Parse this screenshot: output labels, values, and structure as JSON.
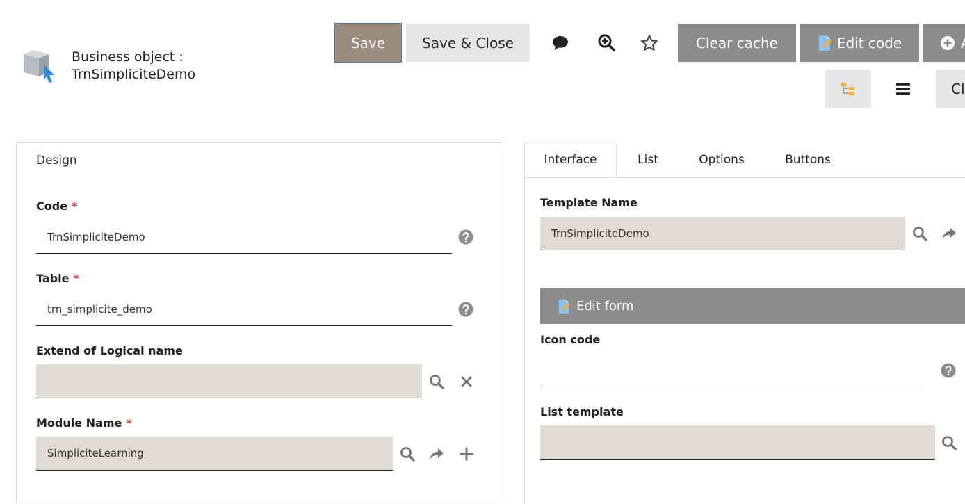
{
  "header": {
    "title_line1": "Business object :",
    "title_line2": "TrnSimpliciteDemo",
    "object_icon": "cube-with-cursor-icon"
  },
  "toolbar": {
    "save_label": "Save",
    "save_close_label": "Save & Close",
    "clear_cache_label": "Clear cache",
    "edit_code_label": "Edit code",
    "add_label_partial": "A",
    "more_label_partial": "Cl",
    "icons": [
      "comment-icon",
      "zoom-search-icon",
      "star-icon",
      "tree-icon",
      "menu-icon"
    ]
  },
  "design_panel": {
    "title": "Design",
    "code": {
      "label": "Code",
      "value": "TrnSimpliciteDemo",
      "required": "*"
    },
    "table": {
      "label": "Table",
      "value": "trn_simplicite_demo",
      "required": "*"
    },
    "extend": {
      "label": "Extend of Logical name",
      "value": ""
    },
    "module": {
      "label": "Module Name",
      "value": "SimpliciteLearning",
      "required": "*"
    }
  },
  "tabs": {
    "items": [
      "Interface",
      "List",
      "Options",
      "Buttons"
    ],
    "active": "Interface"
  },
  "interface_panel": {
    "template": {
      "label": "Template Name",
      "value": "TrnSimpliciteDemo"
    },
    "edit_form_label": "Edit form",
    "icon_code": {
      "label": "Icon code",
      "value": ""
    },
    "list_template": {
      "label": "List template",
      "value": ""
    }
  },
  "colors": {
    "gray_button": "#8c8c8c",
    "readonly_field": "#dfdcd7",
    "required": "#c0392b",
    "save_button": "#9b8c7e"
  }
}
